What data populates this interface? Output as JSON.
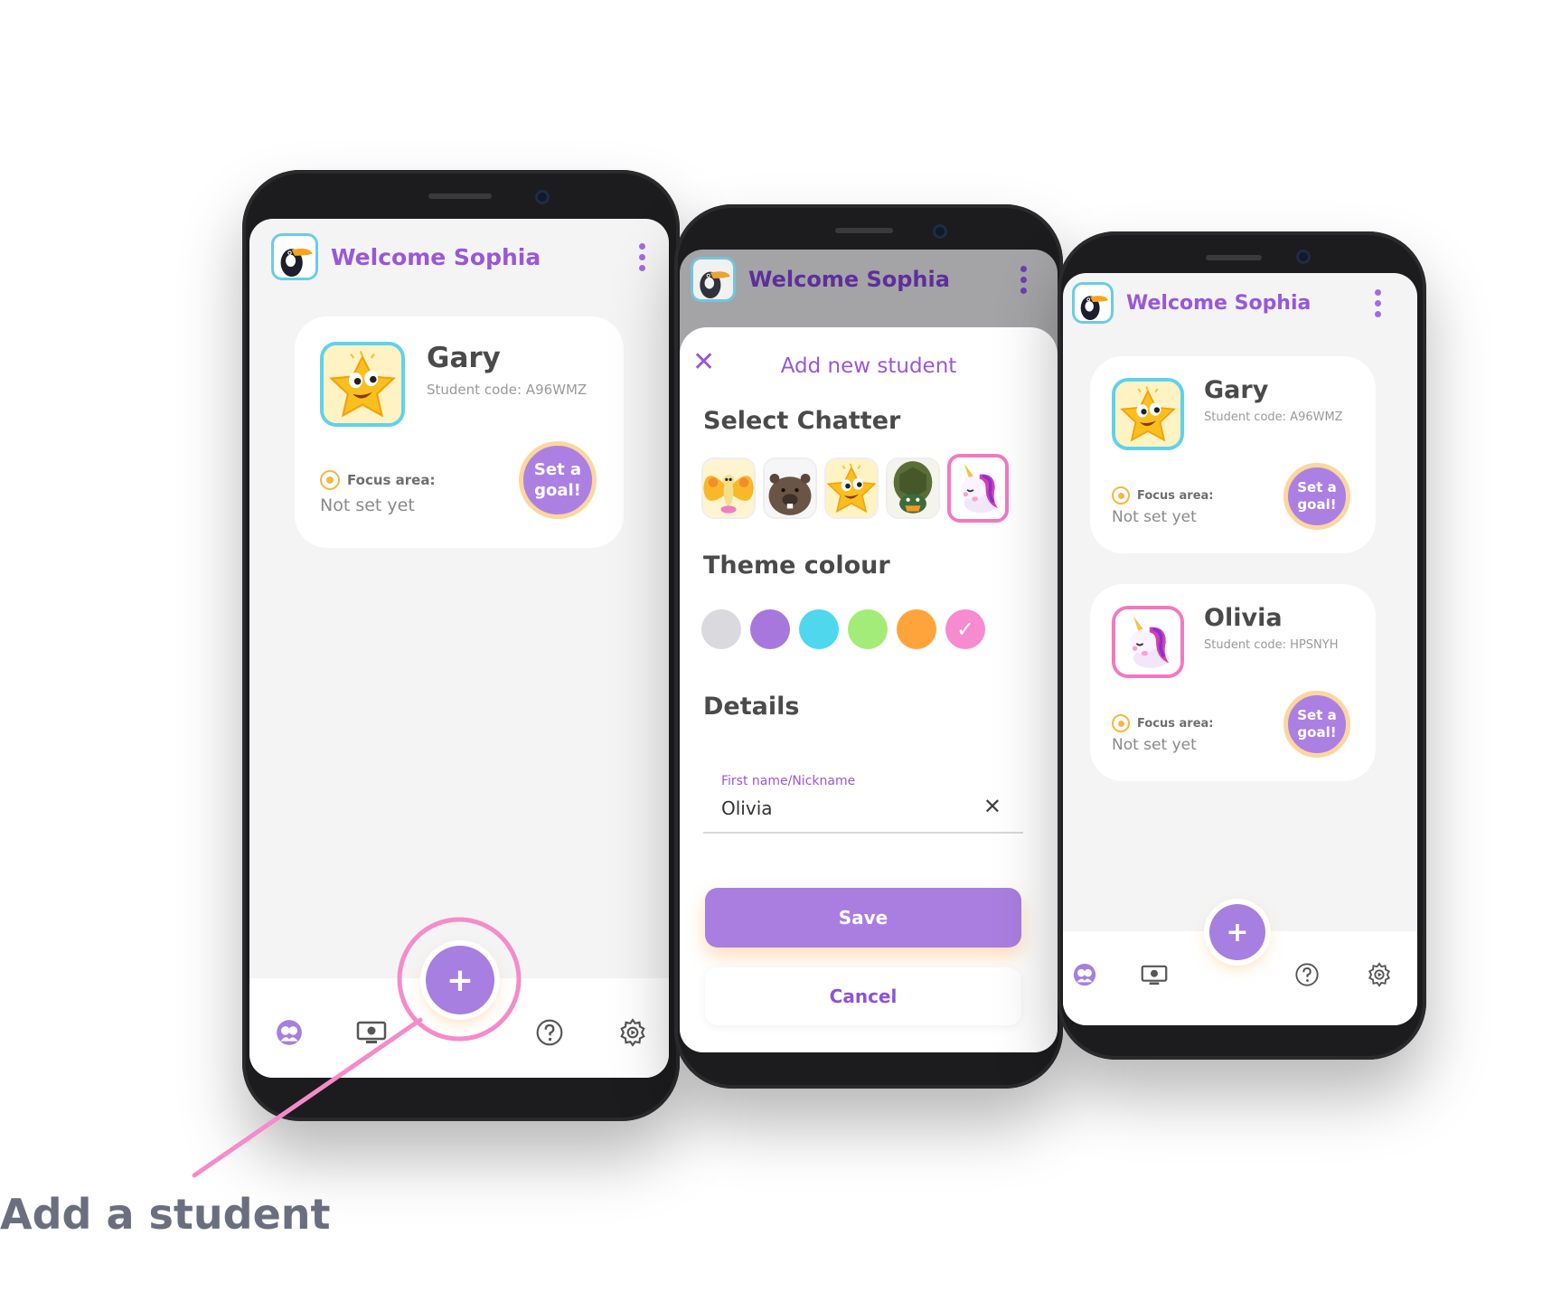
{
  "caption": "Add a student",
  "colors": {
    "accent": "#a97ee0",
    "title": "#9a57d8",
    "highlight": "#f58bc9",
    "goal_border": "#fbd79f"
  },
  "phone1": {
    "header_title": "Welcome Sophia",
    "student": {
      "name": "Gary",
      "code": "Student code: A96WMZ",
      "focus_label": "Focus area:",
      "focus_value": "Not set yet",
      "goal_button": "Set a goal!"
    },
    "fab": "+",
    "nav": [
      "students-icon",
      "screen-icon",
      "help-icon",
      "settings-icon"
    ]
  },
  "phone2": {
    "header_title": "Welcome Sophia",
    "sheet_title": "Add new student",
    "select_chatter": "Select Chatter",
    "chatters": [
      "butterfly",
      "wombat",
      "star",
      "turtle",
      "unicorn"
    ],
    "theme_colour": "Theme colour",
    "colours": [
      "#d9d9de",
      "#a877dd",
      "#4fd7ee",
      "#a2ec77",
      "#ffa43a",
      "#f68bd0"
    ],
    "details": "Details",
    "field_label": "First name/Nickname",
    "field_value": "Olivia",
    "save": "Save",
    "cancel": "Cancel"
  },
  "phone3": {
    "header_title": "Welcome Sophia",
    "students": [
      {
        "name": "Gary",
        "code": "Student code: A96WMZ",
        "focus_label": "Focus area:",
        "focus_value": "Not set yet",
        "goal_button": "Set a goal!"
      },
      {
        "name": "Olivia",
        "code": "Student code: HPSNYH",
        "focus_label": "Focus area:",
        "focus_value": "Not set yet",
        "goal_button": "Set a goal!"
      }
    ],
    "fab": "+"
  }
}
